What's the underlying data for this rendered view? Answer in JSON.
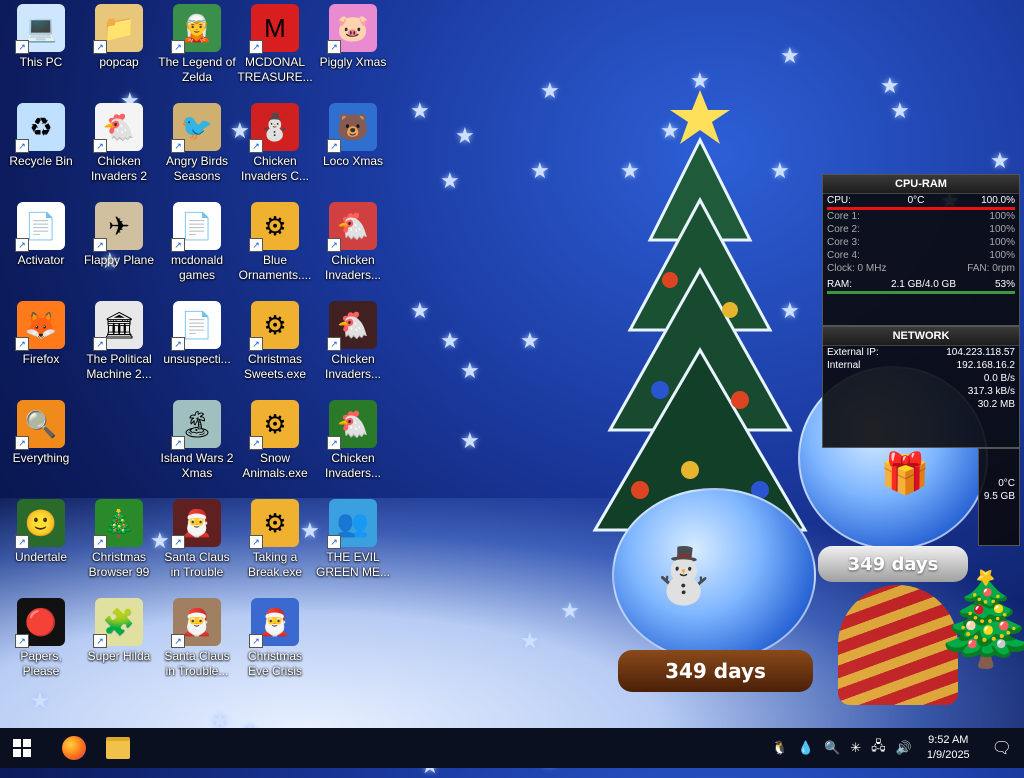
{
  "desktop": {
    "icons": [
      {
        "label": "This PC",
        "glyph": "💻",
        "color": "#cfe6ff"
      },
      {
        "label": "popcap",
        "glyph": "📁",
        "color": "#e9c77a"
      },
      {
        "label": "The Legend of Zelda",
        "glyph": "🧝",
        "color": "#3a8f4a"
      },
      {
        "label": "MCDONAL TREASURE...",
        "glyph": "M",
        "color": "#d81e1e"
      },
      {
        "label": "Piggly Xmas",
        "glyph": "🐷",
        "color": "#e98bd0"
      },
      {
        "label": "Recycle Bin",
        "glyph": "♻",
        "color": "#bfe0ff"
      },
      {
        "label": "Chicken Invaders 2",
        "glyph": "🐔",
        "color": "#f4f4f4"
      },
      {
        "label": "Angry Birds Seasons",
        "glyph": "🐦",
        "color": "#d0b070"
      },
      {
        "label": "Chicken Invaders C...",
        "glyph": "⛄",
        "color": "#d02020"
      },
      {
        "label": "Loco Xmas",
        "glyph": "🐻",
        "color": "#2f6fd0"
      },
      {
        "label": "Activator",
        "glyph": "📄",
        "color": "#ffffff"
      },
      {
        "label": "Flappy Plane",
        "glyph": "✈",
        "color": "#d0c0a0"
      },
      {
        "label": "mcdonald games",
        "glyph": "📄",
        "color": "#ffffff"
      },
      {
        "label": "Blue Ornaments....",
        "glyph": "⚙",
        "color": "#f0b030"
      },
      {
        "label": "Chicken Invaders...",
        "glyph": "🐔",
        "color": "#d04040"
      },
      {
        "label": "Firefox",
        "glyph": "🦊",
        "color": "#ff7a1a"
      },
      {
        "label": "The Political Machine 2...",
        "glyph": "🏛",
        "color": "#e8e8e8"
      },
      {
        "label": "unsuspecti...",
        "glyph": "📄",
        "color": "#ffffff"
      },
      {
        "label": "Christmas Sweets.exe",
        "glyph": "⚙",
        "color": "#f0b030"
      },
      {
        "label": "Chicken Invaders...",
        "glyph": "🐔",
        "color": "#402020"
      },
      {
        "label": "Everything",
        "glyph": "🔍",
        "color": "#f08a1a"
      },
      {
        "label": "Island Wars 2 Xmas",
        "glyph": "🏝",
        "color": "#a0c0c0"
      },
      {
        "label": "Snow Animals.exe",
        "glyph": "⚙",
        "color": "#f0b030"
      },
      {
        "label": "Chicken Invaders...",
        "glyph": "🐔",
        "color": "#2a7a2a"
      },
      {
        "label": "Undertale",
        "glyph": "🙂",
        "color": "#2a6a2a"
      },
      {
        "label": "Christmas Browser 99",
        "glyph": "🎄",
        "color": "#2a8a2a"
      },
      {
        "label": "Santa Claus in Trouble",
        "glyph": "🎅",
        "color": "#602020"
      },
      {
        "label": "Taking a Break.exe",
        "glyph": "⚙",
        "color": "#f0b030"
      },
      {
        "label": "THE EVIL GREEN ME...",
        "glyph": "👥",
        "color": "#3aa0e0"
      },
      {
        "label": "Papers, Please",
        "glyph": "🔴",
        "color": "#111111"
      },
      {
        "label": "Super Hilda",
        "glyph": "🧩",
        "color": "#e0e0a0"
      },
      {
        "label": "Santa Claus in Trouble... A...",
        "glyph": "🎅",
        "color": "#a08060"
      },
      {
        "label": "Christmas Eve Crisis",
        "glyph": "🎅",
        "color": "#3a6ad0"
      }
    ]
  },
  "cpu_gadget": {
    "title": "CPU-RAM",
    "cpu_label": "CPU:",
    "cpu_temp": "0°C",
    "cpu_pct": "100.0%",
    "cores": [
      {
        "label": "Core 1:",
        "value": "100%"
      },
      {
        "label": "Core 2:",
        "value": "100%"
      },
      {
        "label": "Core 3:",
        "value": "100%"
      },
      {
        "label": "Core 4:",
        "value": "100%"
      }
    ],
    "clock_label": "Clock: 0 MHz",
    "fan_label": "FAN: 0rpm",
    "ram_label": "RAM:",
    "ram_value": "2.1 GB/4.0 GB",
    "ram_pct": "53%"
  },
  "network_gadget": {
    "title": "NETWORK",
    "external_label": "External IP:",
    "external_ip": "104.223.118.57",
    "internal_label": "Internal",
    "internal_ip": "192.168.16.2",
    "rate1": "0.0 B/s",
    "rate2": "317.3 kB/s",
    "total": "30.2 MB"
  },
  "globes": {
    "small_days": "349 days",
    "big_days": "349 days"
  },
  "extra_gadget": {
    "temp": "0°C",
    "value": "9.5 GB"
  },
  "taskbar": {
    "start_icon": "windows-start-icon",
    "pinned": [
      "firefox-icon",
      "file-explorer-icon"
    ],
    "time": "9:52 AM",
    "date": "1/9/2025"
  },
  "colors": {
    "accent": "#1b3aa0",
    "taskbar": "#0b1020",
    "gadget_bar": "#ee1111"
  }
}
